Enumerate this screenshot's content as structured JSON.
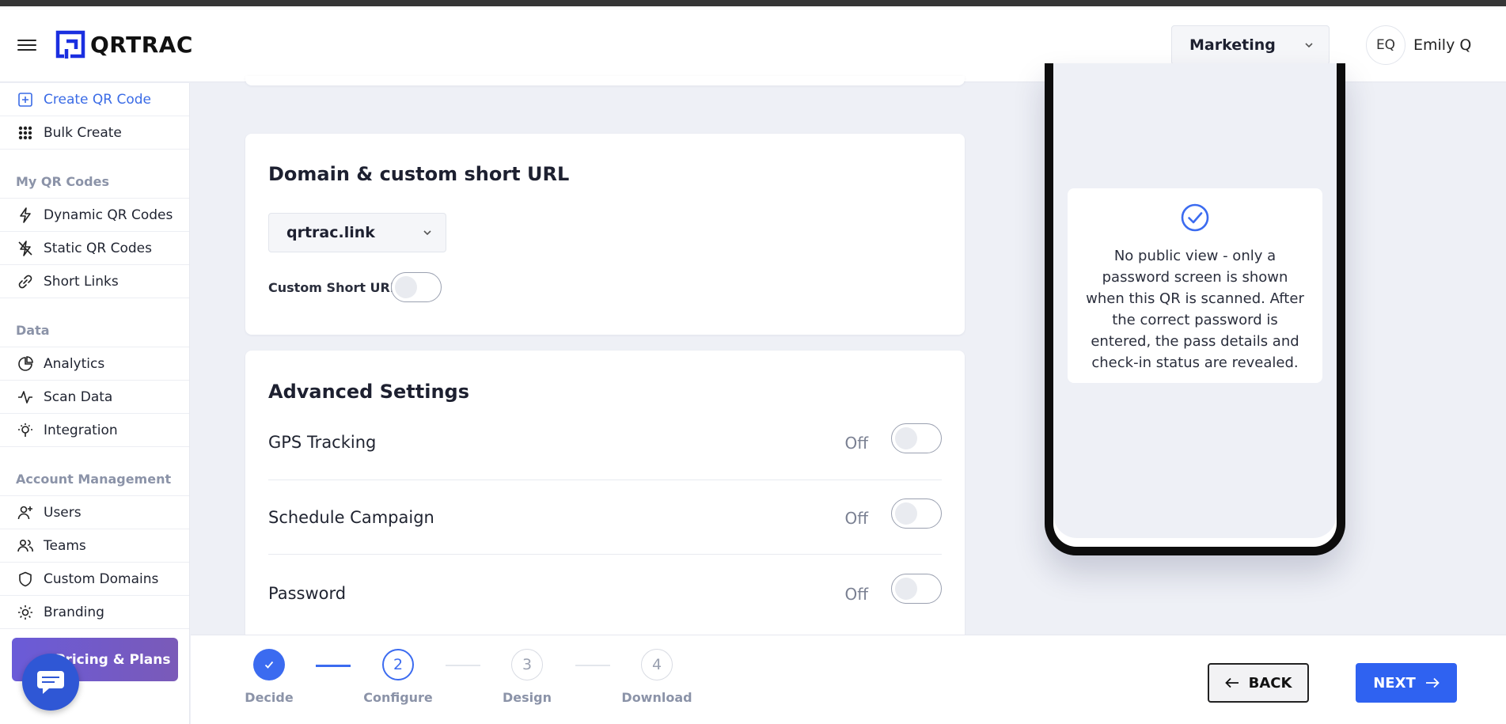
{
  "app": {
    "logo_text": "QRTRAC"
  },
  "header": {
    "workspace": "Marketing",
    "user_initials": "EQ",
    "user_name": "Emily Q"
  },
  "sidebar": {
    "items_top": [
      {
        "label": "Create QR Code",
        "icon": "plus-square-icon",
        "active": true
      },
      {
        "label": "Bulk Create",
        "icon": "grid-dots-icon"
      }
    ],
    "section_qr": "My QR Codes",
    "items_qr": [
      {
        "label": "Dynamic QR Codes",
        "icon": "lightning-icon"
      },
      {
        "label": "Static QR Codes",
        "icon": "lightning-off-icon"
      },
      {
        "label": "Short Links",
        "icon": "link-icon"
      }
    ],
    "section_data": "Data",
    "items_data": [
      {
        "label": "Analytics",
        "icon": "pie-chart-icon"
      },
      {
        "label": "Scan Data",
        "icon": "activity-icon"
      },
      {
        "label": "Integration",
        "icon": "plug-icon"
      }
    ],
    "section_account": "Account Management",
    "items_account": [
      {
        "label": "Users",
        "icon": "user-plus-icon"
      },
      {
        "label": "Teams",
        "icon": "users-icon"
      },
      {
        "label": "Custom Domains",
        "icon": "shield-icon"
      },
      {
        "label": "Branding",
        "icon": "sun-icon"
      }
    ],
    "pricing_label": "Pricing & Plans"
  },
  "domain_card": {
    "title": "Domain & custom short URL",
    "selected_domain": "qrtrac.link",
    "custom_short_url_label": "Custom Short URL"
  },
  "advanced": {
    "title": "Advanced Settings",
    "rows": [
      {
        "label": "GPS Tracking",
        "state": "Off"
      },
      {
        "label": "Schedule Campaign",
        "state": "Off"
      },
      {
        "label": "Password",
        "state": "Off"
      }
    ]
  },
  "preview": {
    "notice": "No public view - only a password screen is shown when this QR is scanned. After the correct password is entered, the pass details and check-in status are revealed."
  },
  "stepper": {
    "steps": [
      {
        "num": "",
        "label": "Decide",
        "status": "done"
      },
      {
        "num": "2",
        "label": "Configure",
        "status": "current"
      },
      {
        "num": "3",
        "label": "Design",
        "status": "todo"
      },
      {
        "num": "4",
        "label": "Download",
        "status": "todo"
      }
    ],
    "back_label": "BACK",
    "next_label": "NEXT"
  },
  "colors": {
    "accent": "#2f62f1",
    "active_nav": "#3a6be6",
    "pricing_gradient_start": "#6a5bd8",
    "pricing_gradient_end": "#7a5ab8"
  }
}
